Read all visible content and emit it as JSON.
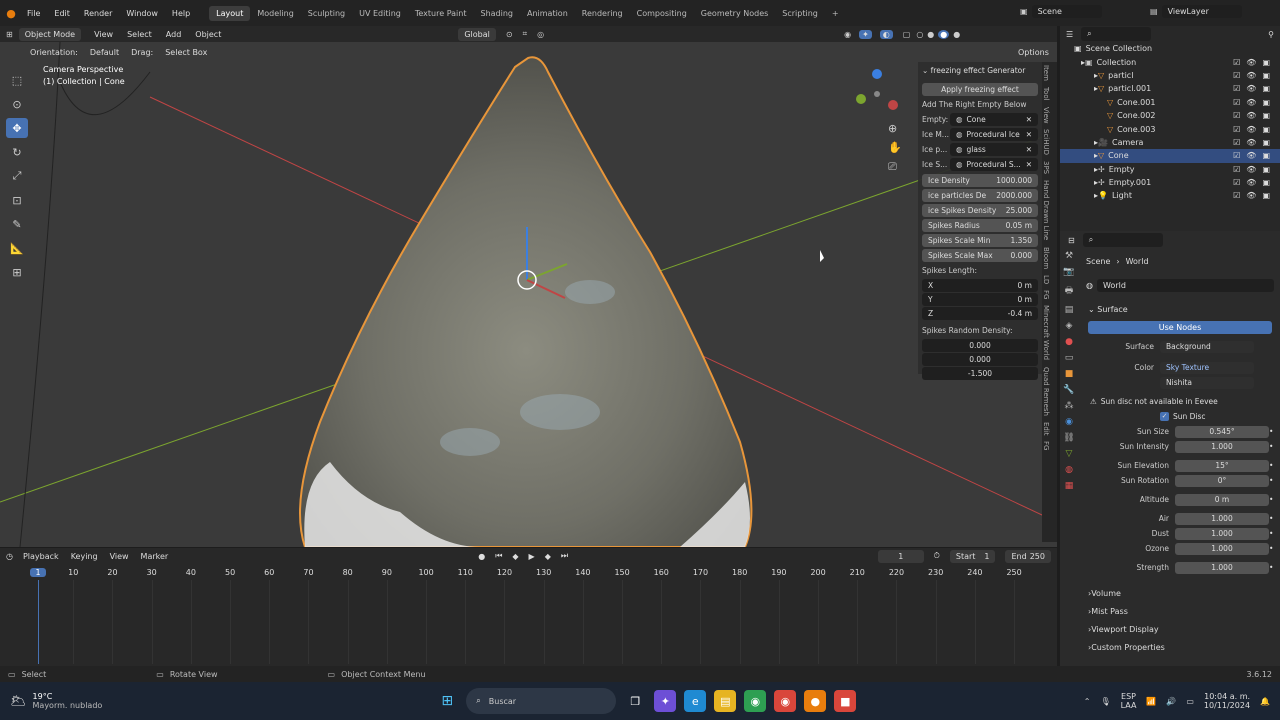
{
  "top_menu": {
    "items": [
      "File",
      "Edit",
      "Render",
      "Window",
      "Help"
    ],
    "workspaces": [
      "Layout",
      "Modeling",
      "Sculpting",
      "UV Editing",
      "Texture Paint",
      "Shading",
      "Animation",
      "Rendering",
      "Compositing",
      "Geometry Nodes",
      "Scripting"
    ],
    "add_tab": "+",
    "scene": "Scene",
    "view_layer": "ViewLayer"
  },
  "viewport_header": {
    "mode": "Object Mode",
    "menus": [
      "View",
      "Select",
      "Add",
      "Object"
    ],
    "transform": "Global",
    "orientation_label": "Orientation:",
    "orientation_value": "Default",
    "drag_label": "Drag:",
    "drag_value": "Select Box",
    "options": "Options"
  },
  "viewport": {
    "title": "Camera Perspective",
    "subtitle": "(1) Collection | Cone"
  },
  "n_panel": {
    "header": "freezing effect Generator",
    "apply_button": "Apply freezing effect",
    "hint": "Add The Right Empty Below",
    "pickers": [
      {
        "label": "Empty:",
        "value": "Cone"
      },
      {
        "label": "Ice M...",
        "value": "Procedural Ice"
      },
      {
        "label": "Ice p...",
        "value": "glass"
      },
      {
        "label": "Ice S...",
        "value": "Procedural S..."
      }
    ],
    "fields": [
      {
        "label": "Ice Density",
        "value": "1000.000"
      },
      {
        "label": "ice particles De",
        "value": "2000.000"
      },
      {
        "label": "ice Spikes Density",
        "value": "25.000"
      },
      {
        "label": "Spikes Radius",
        "value": "0.05 m"
      },
      {
        "label": "Spikes Scale Min",
        "value": "1.350"
      },
      {
        "label": "Spikes Scale Max",
        "value": "0.000"
      }
    ],
    "spikes_length_label": "Spikes Length:",
    "spikes_length": [
      {
        "label": "X",
        "value": "0 m"
      },
      {
        "label": "Y",
        "value": "0 m"
      },
      {
        "label": "Z",
        "value": "-0.4 m"
      }
    ],
    "spikes_random_label": "Spikes Random Density:",
    "spikes_random": [
      "0.000",
      "0.000",
      "-1.500"
    ]
  },
  "side_tabs": [
    "Item",
    "Tool",
    "View",
    "SciHUD",
    "3PS",
    "Hand Drawn Line",
    "Bloom",
    "LD",
    "FG",
    "Minecraft World",
    "Quad Remesh",
    "Edit",
    "FG"
  ],
  "outliner": {
    "root": "Scene Collection",
    "rows": [
      {
        "label": "Collection",
        "indent": 1
      },
      {
        "label": "particl",
        "indent": 2
      },
      {
        "label": "particl.001",
        "indent": 2
      },
      {
        "label": "Cone.001",
        "indent": 3
      },
      {
        "label": "Cone.002",
        "indent": 3
      },
      {
        "label": "Cone.003",
        "indent": 3
      },
      {
        "label": "Camera",
        "indent": 2
      },
      {
        "label": "Cone",
        "indent": 2,
        "selected": true
      },
      {
        "label": "Empty",
        "indent": 2
      },
      {
        "label": "Empty.001",
        "indent": 2
      },
      {
        "label": "Light",
        "indent": 2
      }
    ]
  },
  "properties": {
    "breadcrumb_scene": "Scene",
    "breadcrumb_world": "World",
    "world_name": "World",
    "surface_section": "Surface",
    "use_nodes": "Use Nodes",
    "surface_label": "Surface",
    "surface_value": "Background",
    "color_label": "Color",
    "color_value": "Sky Texture",
    "sky_type": "Nishita",
    "warning": "Sun disc not available in Eevee",
    "sun_disc": "Sun Disc",
    "rows": [
      {
        "label": "Sun Size",
        "value": "0.545°"
      },
      {
        "label": "Sun Intensity",
        "value": "1.000"
      },
      {
        "label": "Sun Elevation",
        "value": "15°"
      },
      {
        "label": "Sun Rotation",
        "value": "0°"
      },
      {
        "label": "Altitude",
        "value": "0 m"
      },
      {
        "label": "Air",
        "value": "1.000"
      },
      {
        "label": "Dust",
        "value": "1.000"
      },
      {
        "label": "Ozone",
        "value": "1.000"
      },
      {
        "label": "Strength",
        "value": "1.000"
      }
    ],
    "collapsed_sections": [
      "Volume",
      "Mist Pass",
      "Viewport Display",
      "Custom Properties"
    ]
  },
  "timeline": {
    "menus": [
      "Playback",
      "Keying",
      "View",
      "Marker"
    ],
    "current_frame": "1",
    "start_label": "Start",
    "start": "1",
    "end_label": "End",
    "end": "250",
    "ticks": [
      "1",
      "10",
      "20",
      "30",
      "40",
      "50",
      "60",
      "70",
      "80",
      "90",
      "100",
      "110",
      "120",
      "130",
      "140",
      "150",
      "160",
      "170",
      "180",
      "190",
      "200",
      "210",
      "220",
      "230",
      "240",
      "250"
    ]
  },
  "status_bar": {
    "select": "Select",
    "rotate": "Rotate View",
    "context": "Object Context Menu",
    "version": "3.6.12"
  },
  "taskbar": {
    "weather_temp": "19°C",
    "weather_desc": "Mayorm. nublado",
    "search_placeholder": "Buscar",
    "lang_1": "ESP",
    "lang_2": "LAA",
    "time": "10:04 a. m.",
    "date": "10/11/2024"
  },
  "colors": {
    "accent": "#4772b3",
    "selection_outline": "#e8963a",
    "x_axis": "#c04545",
    "y_axis": "#7ca52f"
  }
}
